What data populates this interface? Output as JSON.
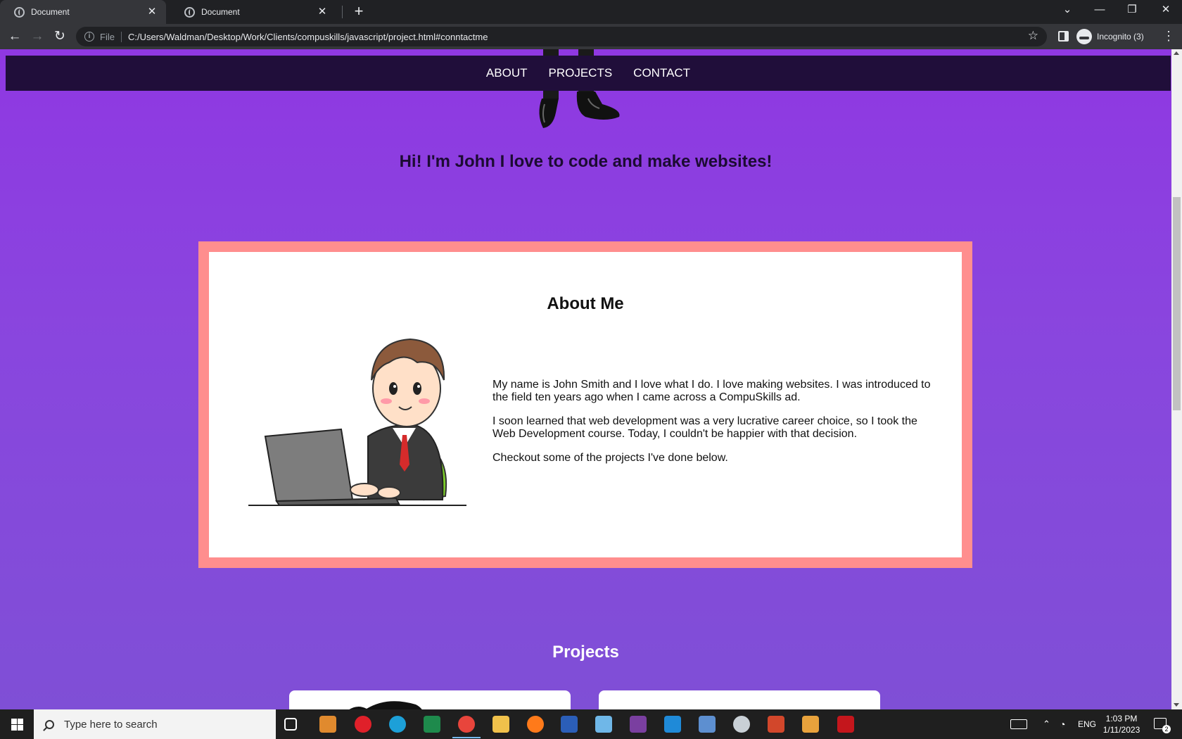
{
  "browser": {
    "tabs": [
      {
        "title": "Document",
        "active": true
      },
      {
        "title": "Document",
        "active": false
      }
    ],
    "address": {
      "scheme": "File",
      "url": "C:/Users/Waldman/Desktop/Work/Clients/compuskills/javascript/project.html#conntactme"
    },
    "profile_label": "Incognito (3)"
  },
  "page": {
    "nav": {
      "about": "ABOUT",
      "projects": "PROJECTS",
      "contact": "CONTACT"
    },
    "hero_text": "Hi! I'm John I love to code and make websites!",
    "about": {
      "title": "About Me",
      "paragraphs": [
        "My name is John Smith and I love what I do. I love making websites. I was introduced to the field ten years ago when I came across a CompuSkills ad.",
        "I soon learned that web development was a very lucrative career choice, so I took the Web Development course. Today, I couldn't be happier with that decision.",
        "Checkout some of the projects I've done below."
      ]
    },
    "projects_title": "Projects",
    "colors": {
      "page_top": "#8f38e2",
      "page_bottom": "#7f4fd6",
      "navbar": "#200e3a",
      "about_border": "#ff8e8e"
    }
  },
  "taskbar": {
    "search_placeholder": "Type here to search",
    "language": "ENG",
    "time": "1:03 PM",
    "date": "1/11/2023",
    "notification_count": "2",
    "apps": [
      "task-view",
      "media-player",
      "opera",
      "edge",
      "excel",
      "chrome",
      "file-explorer",
      "firefox",
      "word",
      "notepad",
      "winrar",
      "vscode",
      "image-viewer",
      "paint",
      "powerpoint",
      "outlook",
      "acrobat"
    ]
  }
}
